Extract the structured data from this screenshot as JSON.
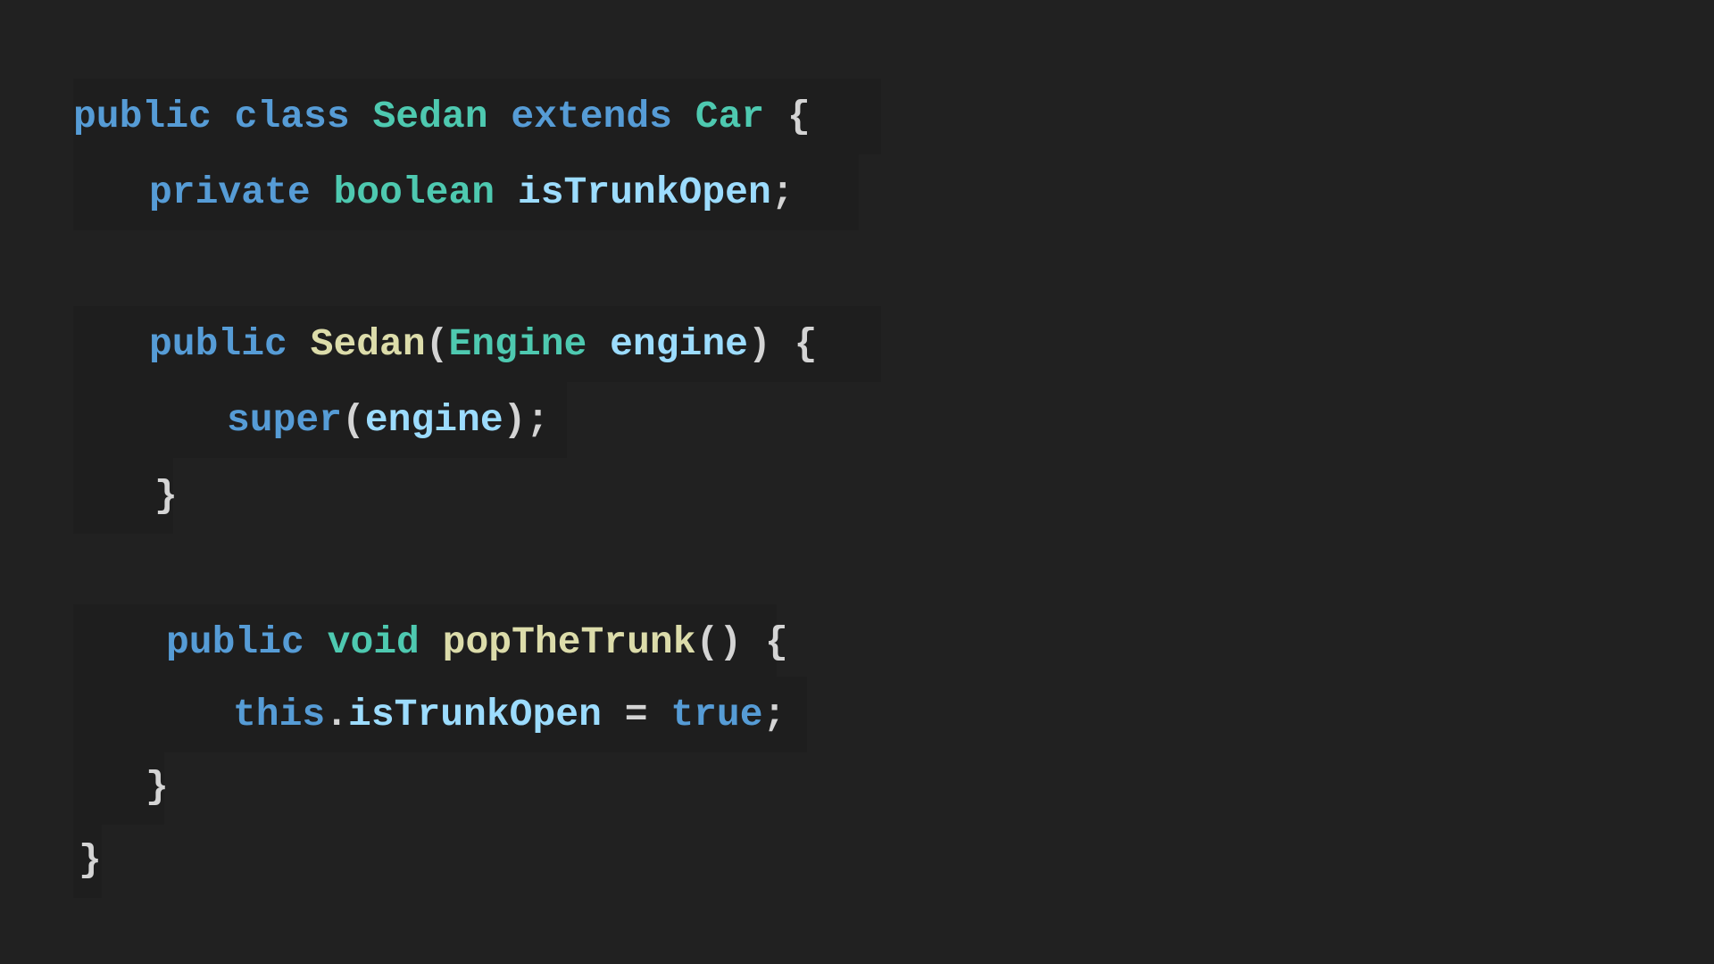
{
  "editor": {
    "language": "Java",
    "background": "#212121",
    "colors": {
      "keyword": "#569cd6",
      "type": "#4ec9b0",
      "variable": "#9cdcfe",
      "function": "#dcdcaa",
      "punctuation": "#d4d4d4"
    },
    "lines": [
      {
        "tokens": [
          {
            "t": "public",
            "c": "kw"
          },
          {
            "t": " ",
            "c": "pun"
          },
          {
            "t": "class",
            "c": "kw"
          },
          {
            "t": " ",
            "c": "pun"
          },
          {
            "t": "Sedan",
            "c": "type"
          },
          {
            "t": " ",
            "c": "pun"
          },
          {
            "t": "extends",
            "c": "kw"
          },
          {
            "t": " ",
            "c": "pun"
          },
          {
            "t": "Car",
            "c": "type"
          },
          {
            "t": " ",
            "c": "pun"
          },
          {
            "t": "{",
            "c": "pun"
          }
        ]
      },
      {
        "tokens": [
          {
            "t": "private",
            "c": "kw"
          },
          {
            "t": " ",
            "c": "pun"
          },
          {
            "t": "boolean",
            "c": "type"
          },
          {
            "t": " ",
            "c": "pun"
          },
          {
            "t": "isTrunkOpen",
            "c": "var"
          },
          {
            "t": ";",
            "c": "pun"
          }
        ]
      },
      {
        "tokens": [
          {
            "t": "public",
            "c": "kw"
          },
          {
            "t": " ",
            "c": "pun"
          },
          {
            "t": "Sedan",
            "c": "fn"
          },
          {
            "t": "(",
            "c": "pun"
          },
          {
            "t": "Engine",
            "c": "type"
          },
          {
            "t": " ",
            "c": "pun"
          },
          {
            "t": "engine",
            "c": "var"
          },
          {
            "t": ")",
            "c": "pun"
          },
          {
            "t": " ",
            "c": "pun"
          },
          {
            "t": "{",
            "c": "pun"
          }
        ]
      },
      {
        "tokens": [
          {
            "t": "super",
            "c": "kw"
          },
          {
            "t": "(",
            "c": "pun"
          },
          {
            "t": "engine",
            "c": "var"
          },
          {
            "t": ");",
            "c": "pun"
          }
        ]
      },
      {
        "tokens": [
          {
            "t": "}",
            "c": "pun"
          }
        ]
      },
      {
        "tokens": [
          {
            "t": "public",
            "c": "kw"
          },
          {
            "t": " ",
            "c": "pun"
          },
          {
            "t": "void",
            "c": "type"
          },
          {
            "t": " ",
            "c": "pun"
          },
          {
            "t": "popTheTrunk",
            "c": "fn"
          },
          {
            "t": "()",
            "c": "pun"
          },
          {
            "t": " ",
            "c": "pun"
          },
          {
            "t": "{",
            "c": "pun"
          }
        ]
      },
      {
        "tokens": [
          {
            "t": "this",
            "c": "kw"
          },
          {
            "t": ".",
            "c": "pun"
          },
          {
            "t": "isTrunkOpen",
            "c": "var"
          },
          {
            "t": " ",
            "c": "pun"
          },
          {
            "t": "=",
            "c": "pun"
          },
          {
            "t": " ",
            "c": "pun"
          },
          {
            "t": "true",
            "c": "kw"
          },
          {
            "t": ";",
            "c": "pun"
          }
        ]
      },
      {
        "tokens": [
          {
            "t": "}",
            "c": "pun"
          }
        ]
      },
      {
        "tokens": [
          {
            "t": "}",
            "c": "pun"
          }
        ]
      }
    ]
  }
}
